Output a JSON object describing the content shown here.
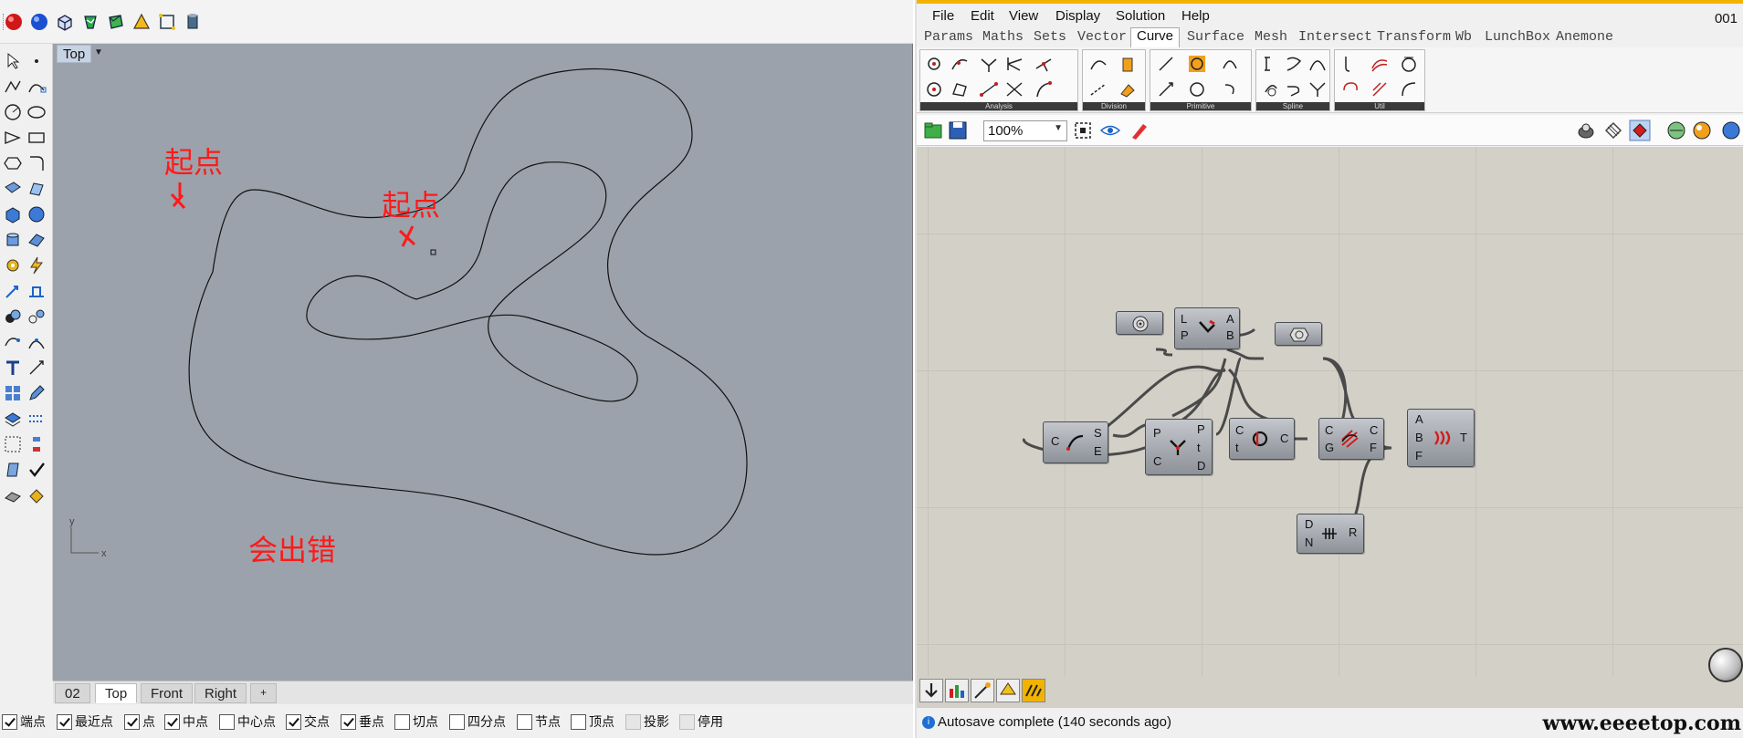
{
  "rhino": {
    "viewport_label": "Top",
    "annotations": {
      "start1": "起点",
      "start2": "起点",
      "error": "会出错"
    },
    "axis": {
      "x": "x",
      "y": "y"
    },
    "tabs": [
      "02",
      "Top",
      "Front",
      "Right"
    ],
    "active_tab": "Top",
    "add_tab": "+",
    "osnaps": [
      {
        "label": "端点",
        "checked": true
      },
      {
        "label": "最近点",
        "checked": true
      },
      {
        "label": "点",
        "checked": true
      },
      {
        "label": "中点",
        "checked": true
      },
      {
        "label": "中心点",
        "checked": false
      },
      {
        "label": "交点",
        "checked": true
      },
      {
        "label": "垂点",
        "checked": true
      },
      {
        "label": "切点",
        "checked": false
      },
      {
        "label": "四分点",
        "checked": false
      },
      {
        "label": "节点",
        "checked": false
      },
      {
        "label": "顶点",
        "checked": false
      },
      {
        "label": "投影",
        "checked": false,
        "disabled": true
      },
      {
        "label": "停用",
        "checked": false,
        "disabled": true
      }
    ]
  },
  "gh": {
    "menu": [
      "File",
      "Edit",
      "View",
      "Display",
      "Solution",
      "Help"
    ],
    "title_number": "001",
    "component_tabs": [
      "Params",
      "Maths",
      "Sets",
      "Vector",
      "Curve",
      "Surface",
      "Mesh",
      "Intersect",
      "Transform",
      "Wb",
      "LunchBox",
      "Anemone"
    ],
    "active_component_tab": "Curve",
    "ribbon_groups": [
      "Analysis",
      "Division",
      "Primitive",
      "Spline",
      "Util"
    ],
    "zoom": "100%",
    "nodes": {
      "lp": {
        "in": [
          "L",
          "P"
        ],
        "out": [
          "A",
          "B"
        ]
      },
      "se": {
        "in": [
          "C"
        ],
        "out": [
          "S",
          "E"
        ]
      },
      "ptd": {
        "in": [
          "P",
          "C"
        ],
        "out": [
          "P",
          "t",
          "D"
        ]
      },
      "ct": {
        "in": [
          "C",
          "t"
        ],
        "out": [
          "C"
        ]
      },
      "cg": {
        "in": [
          "C",
          "G"
        ],
        "out": [
          "C",
          "F"
        ]
      },
      "abf": {
        "in": [
          "A",
          "B",
          "F"
        ],
        "out": [
          "T"
        ]
      },
      "dn": {
        "in": [
          "D",
          "N"
        ],
        "out": [
          "R"
        ]
      }
    },
    "status": "Autosave complete (140 seconds ago)",
    "watermark": "www.eeeetop.com"
  },
  "colors": {
    "accent": "#f2b300",
    "annotation": "#ff1a1a",
    "viewport_bg": "#9ba2ab",
    "canvas_bg": "#d3d0c8"
  }
}
